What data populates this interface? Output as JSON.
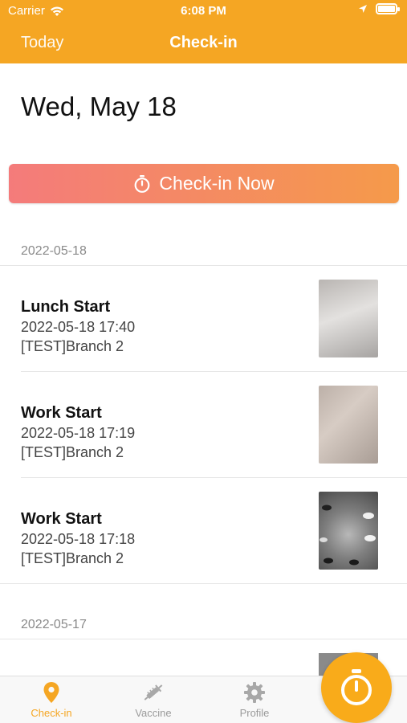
{
  "status_bar": {
    "carrier": "Carrier",
    "time": "6:08 PM"
  },
  "nav": {
    "left_label": "Today",
    "title": "Check-in"
  },
  "date_heading": "Wed, May 18",
  "checkin_button": {
    "label": "Check-in Now"
  },
  "sections": [
    {
      "date": "2022-05-18",
      "items": [
        {
          "title": "Lunch Start",
          "datetime": "2022-05-18 17:40",
          "branch": "[TEST]Branch 2"
        },
        {
          "title": "Work Start",
          "datetime": "2022-05-18 17:19",
          "branch": "[TEST]Branch 2"
        },
        {
          "title": "Work Start",
          "datetime": "2022-05-18 17:18",
          "branch": "[TEST]Branch 2"
        }
      ]
    },
    {
      "date": "2022-05-17",
      "items": []
    }
  ],
  "tabs": [
    {
      "label": "Check-in",
      "icon": "location-pin-icon",
      "active": true
    },
    {
      "label": "Vaccine",
      "icon": "syringe-icon",
      "active": false
    },
    {
      "label": "Profile",
      "icon": "gear-icon",
      "active": false
    }
  ],
  "fab": {
    "icon": "stopwatch-icon"
  },
  "colors": {
    "brand": "#f5a623",
    "button_gradient_start": "#f47b7b",
    "button_gradient_end": "#f59a4a",
    "fab": "#f9ab1a"
  }
}
